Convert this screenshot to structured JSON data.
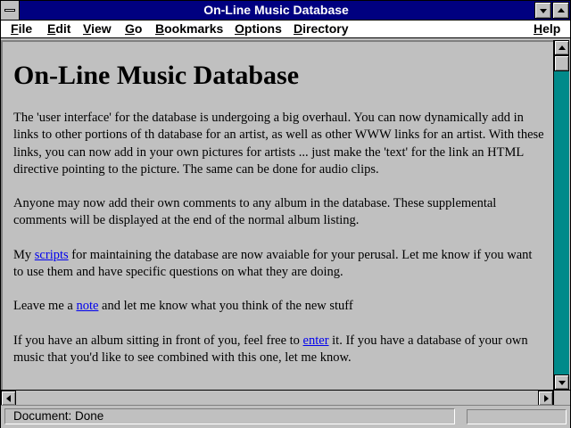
{
  "window": {
    "title": "On-Line Music Database"
  },
  "menu": {
    "file": "File",
    "edit": "Edit",
    "view": "View",
    "go": "Go",
    "bookmarks": "Bookmarks",
    "options": "Options",
    "directory": "Directory",
    "help": "Help"
  },
  "page": {
    "heading": "On-Line Music Database",
    "p1": "The 'user interface' for the database is undergoing a big overhaul. You can now dynamically add in links to other portions of th database for an artist, as well as other WWW links for an artist. With these links, you can now add in your own pictures for artists ... just make the 'text' for the link an HTML directive pointing to the picture. The same can be done for audio clips.",
    "p2": "Anyone may now add their own comments to any album in the database. These supplemental comments will be displayed at the end of the normal album listing.",
    "p3_before": "My ",
    "p3_link": "scripts",
    "p3_after": " for maintaining the database are now avaiable for your perusal. Let me know if you want to use them and have specific questions on what they are doing.",
    "p4_before": "Leave me a ",
    "p4_link": "note",
    "p4_after": " and let me know what you think of the new stuff",
    "p5_before": "If you have an album sitting in front of you, feel free to ",
    "p5_link": "enter",
    "p5_after": " it. If you have a database of your own music that you'd like to see combined with this one, let me know."
  },
  "status": {
    "text": "Document: Done"
  },
  "colors": {
    "titlebar": "#000080",
    "link": "#0000ee",
    "background": "#c0c0c0",
    "scrollbar_track": "#00a8a8"
  },
  "icons": [
    "system-menu-icon",
    "minimize-icon",
    "maximize-icon",
    "scroll-up-icon",
    "scroll-down-icon",
    "scroll-left-icon",
    "scroll-right-icon"
  ]
}
